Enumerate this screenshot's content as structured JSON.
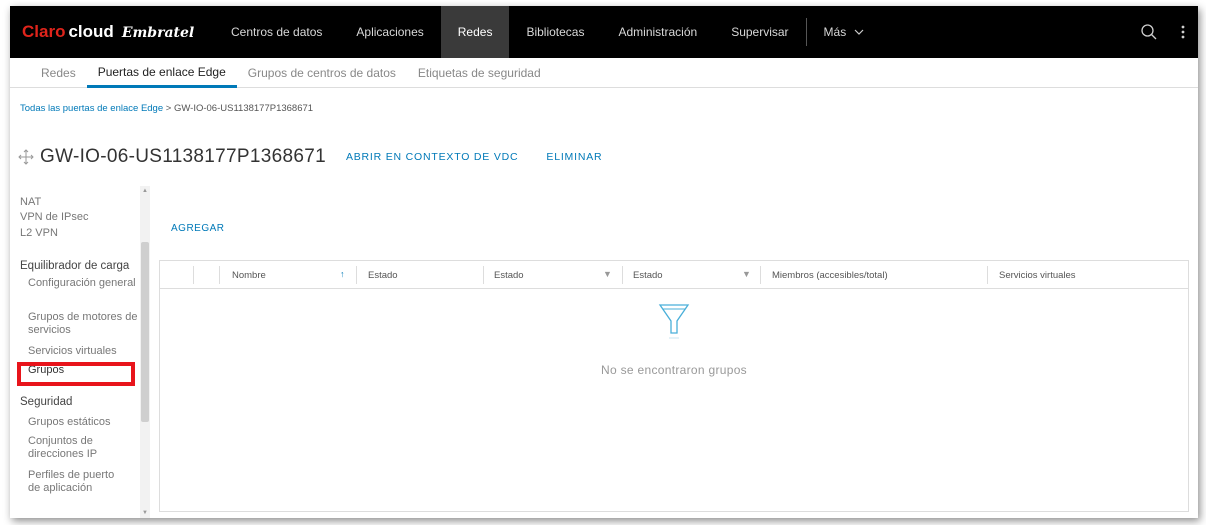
{
  "brand": {
    "claro": "Claro",
    "cloud": "cloud",
    "embratel": "Embratel"
  },
  "topnav": {
    "items": [
      "Centros de datos",
      "Aplicaciones",
      "Redes",
      "Bibliotecas",
      "Administración",
      "Supervisar"
    ],
    "active": "Redes",
    "more_label": "Más"
  },
  "subnav": {
    "tabs": [
      "Redes",
      "Puertas de enlace Edge",
      "Grupos de centros de datos",
      "Etiquetas de seguridad"
    ],
    "active": "Puertas de enlace Edge"
  },
  "breadcrumb": {
    "root": "Todas las puertas de enlace Edge",
    "separator": ">",
    "current": "GW-IO-06-US1138177P1368671"
  },
  "page": {
    "title": "GW-IO-06-US1138177P1368671",
    "action_open": "ABRIR EN CONTEXTO DE VDC",
    "action_delete": "ELIMINAR"
  },
  "sidebar": {
    "nat": "NAT",
    "ipsec": "VPN de IPsec",
    "l2vpn": "L2 VPN",
    "lb_group": "Equilibrador de carga",
    "lb_config": "Configuración general",
    "lb_engines": "Grupos de motores de servicios",
    "lb_vservers": "Servicios virtuales",
    "lb_pools": "Grupos",
    "sec_group": "Seguridad",
    "sec_static": "Grupos estáticos",
    "sec_ipsets": "Conjuntos de direcciones IP",
    "sec_profiles": "Perfiles de puerto de aplicación"
  },
  "main": {
    "add_label": "AGREGAR",
    "columns": [
      "Nombre",
      "Estado",
      "Estado",
      "Estado",
      "Miembros (accesibles/total)",
      "Servicios virtuales"
    ],
    "empty_text": "No se encontraron grupos"
  },
  "colors": {
    "accent": "#0079b8",
    "highlight": "#e8141b",
    "topbar": "#000000"
  }
}
